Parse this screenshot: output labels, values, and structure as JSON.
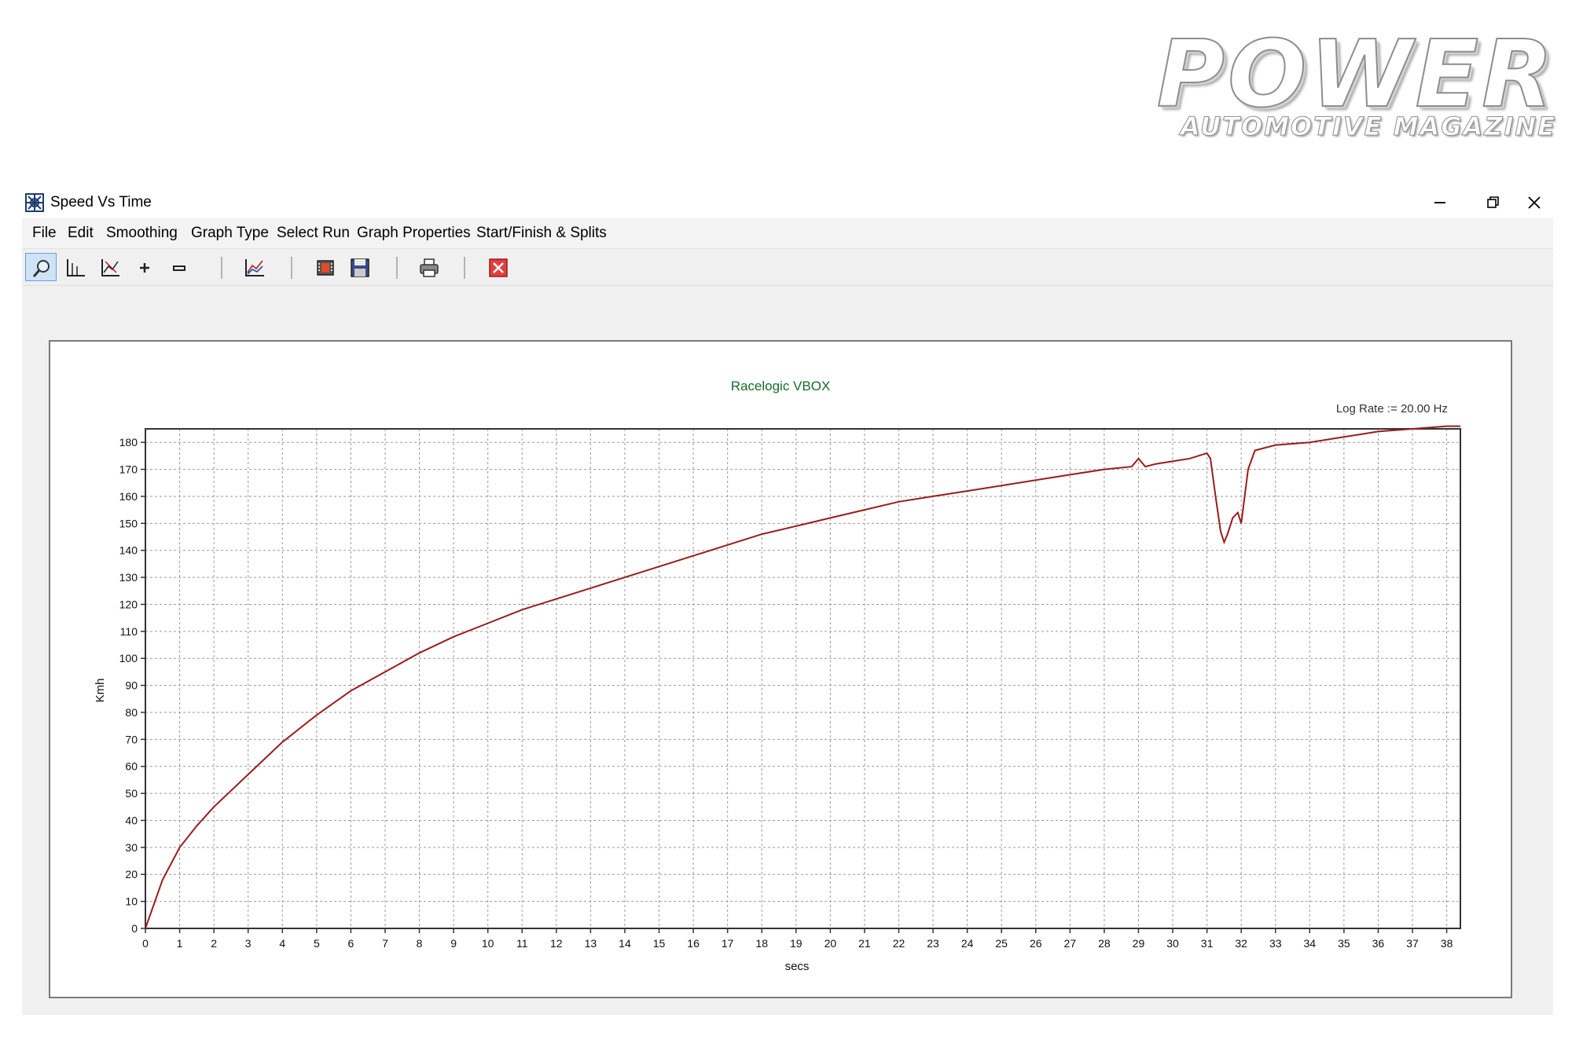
{
  "logo": {
    "title": "POWER",
    "subtitle": "AUTOMOTIVE MAGAZINE"
  },
  "window": {
    "title": "Speed Vs Time",
    "icon": "graph-app-icon",
    "controls": [
      "minimize-icon",
      "restore-icon",
      "close-icon"
    ]
  },
  "menu": [
    "File",
    "Edit",
    "Smoothing",
    "Graph Type",
    "Select Run",
    "Graph Properties",
    "Start/Finish & Splits"
  ],
  "toolbar": [
    {
      "icon": "zoom-icon",
      "active": true
    },
    {
      "icon": "axis-icon",
      "active": false
    },
    {
      "icon": "cursor-graph-icon",
      "active": false
    },
    {
      "icon": "plus-icon",
      "active": false
    },
    {
      "icon": "minus-icon",
      "active": false
    },
    {
      "icon": "multi-graph-icon",
      "active": false
    },
    {
      "icon": "film-icon",
      "active": false
    },
    {
      "icon": "save-icon",
      "active": false
    },
    {
      "icon": "print-icon",
      "active": false
    },
    {
      "icon": "close-red-icon",
      "active": false
    }
  ],
  "colors": {
    "curve": "#9b1c1c",
    "title": "#1a6b2a",
    "grid": "#9a9a9a"
  },
  "chart_data": {
    "type": "line",
    "title": "Racelogic VBOX",
    "annotation": "Log Rate := 20.00 Hz",
    "xlabel": "secs",
    "ylabel": "Kmh",
    "xlim": [
      0,
      38.4
    ],
    "ylim": [
      0,
      185
    ],
    "xticks": [
      0,
      1,
      2,
      3,
      4,
      5,
      6,
      7,
      8,
      9,
      10,
      11,
      12,
      13,
      14,
      15,
      16,
      17,
      18,
      19,
      20,
      21,
      22,
      23,
      24,
      25,
      26,
      27,
      28,
      29,
      30,
      31,
      32,
      33,
      34,
      35,
      36,
      37,
      38
    ],
    "yticks": [
      0,
      10,
      20,
      30,
      40,
      50,
      60,
      70,
      80,
      90,
      100,
      110,
      120,
      130,
      140,
      150,
      160,
      170,
      180
    ],
    "grid": true,
    "series": [
      {
        "x": [
          0,
          0.5,
          1,
          1.5,
          2,
          2.5,
          3,
          4,
          5,
          6,
          7,
          8,
          9,
          10,
          11,
          12,
          13,
          14,
          15,
          16,
          17,
          18,
          19,
          20,
          21,
          22,
          23,
          24,
          25,
          26,
          27,
          28,
          28.8,
          29.0,
          29.2,
          29.5,
          30,
          30.5,
          31.0,
          31.1,
          31.25,
          31.4,
          31.5,
          31.6,
          31.75,
          31.9,
          32.0,
          32.2,
          32.4,
          33,
          34,
          35,
          35.5,
          36,
          37,
          38,
          38.4
        ],
        "y": [
          0,
          18,
          30,
          38,
          45,
          51,
          57,
          69,
          79,
          88,
          95,
          102,
          108,
          113,
          118,
          122,
          126,
          130,
          134,
          138,
          142,
          146,
          149,
          152,
          155,
          158,
          160,
          162,
          164,
          166,
          168,
          170,
          171,
          174,
          171,
          172,
          173,
          174,
          176,
          174,
          160,
          147,
          143,
          146,
          152,
          154,
          150,
          170,
          177,
          179,
          180,
          182,
          183,
          184,
          185,
          186,
          186
        ]
      }
    ]
  }
}
